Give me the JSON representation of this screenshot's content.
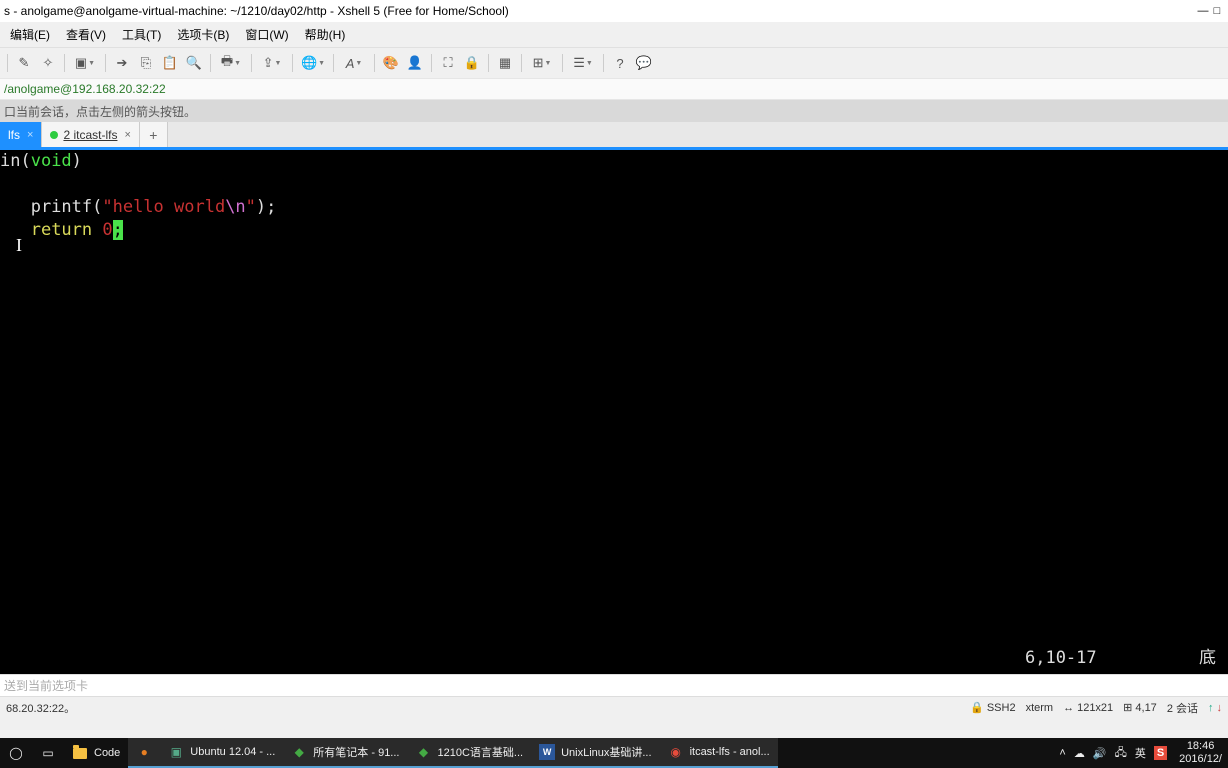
{
  "titlebar": {
    "title": "s - anolgame@anolgame-virtual-machine: ~/1210/day02/http - Xshell 5 (Free for Home/School)"
  },
  "menu": {
    "edit": "编辑(E)",
    "view": "查看(V)",
    "tools": "工具(T)",
    "options": "选项卡(B)",
    "window": "窗口(W)",
    "help": "帮助(H)"
  },
  "toolbar": {
    "icons": [
      "brush-icon",
      "wand-icon",
      "connect-icon",
      "arrow-icon",
      "copy-icon",
      "paste-icon",
      "search-icon",
      "print-icon",
      "send-icon",
      "globe-icon",
      "font-icon",
      "palette-icon",
      "user-icon",
      "fullscreen-icon",
      "lock-icon",
      "grid-icon",
      "plus-window-icon",
      "column-icon",
      "help-icon",
      "chat-icon"
    ]
  },
  "address": {
    "text": "/anolgame@192.168.20.32:22"
  },
  "hint": {
    "text": "口当前会话，点击左侧的箭头按钮。"
  },
  "tabs": {
    "tab1": {
      "label": "lfs"
    },
    "tab2": {
      "label": "2 itcast-lfs"
    }
  },
  "code": {
    "l1a": "in(",
    "l1b": "void",
    "l1c": ")",
    "l2a": "   printf(",
    "l2b": "\"hello world",
    "l2c": "\\n",
    "l2d": "\"",
    "l2e": ");",
    "l3a": "   ",
    "l3b": "return",
    "l3c": " ",
    "l3d": "0",
    "l3e": ";",
    "status": "6,10-17",
    "statusR": "底"
  },
  "send": {
    "placeholder": "送到当前选项卡"
  },
  "status": {
    "left": "68.20.32:22。",
    "ssh": "SSH2",
    "term": "xterm",
    "size": "121x21",
    "pos": "4,17",
    "sess": "2 会话"
  },
  "taskbar": {
    "code": "Code",
    "ubuntu": "Ubuntu 12.04 - ...",
    "notes": "所有笔记本 - 91...",
    "c1210": "1210C语言基础...",
    "word": "UnixLinux基础讲...",
    "xshell": "itcast-lfs - anol...",
    "ime": "英",
    "time": "18:46",
    "date": "2016/12/"
  }
}
